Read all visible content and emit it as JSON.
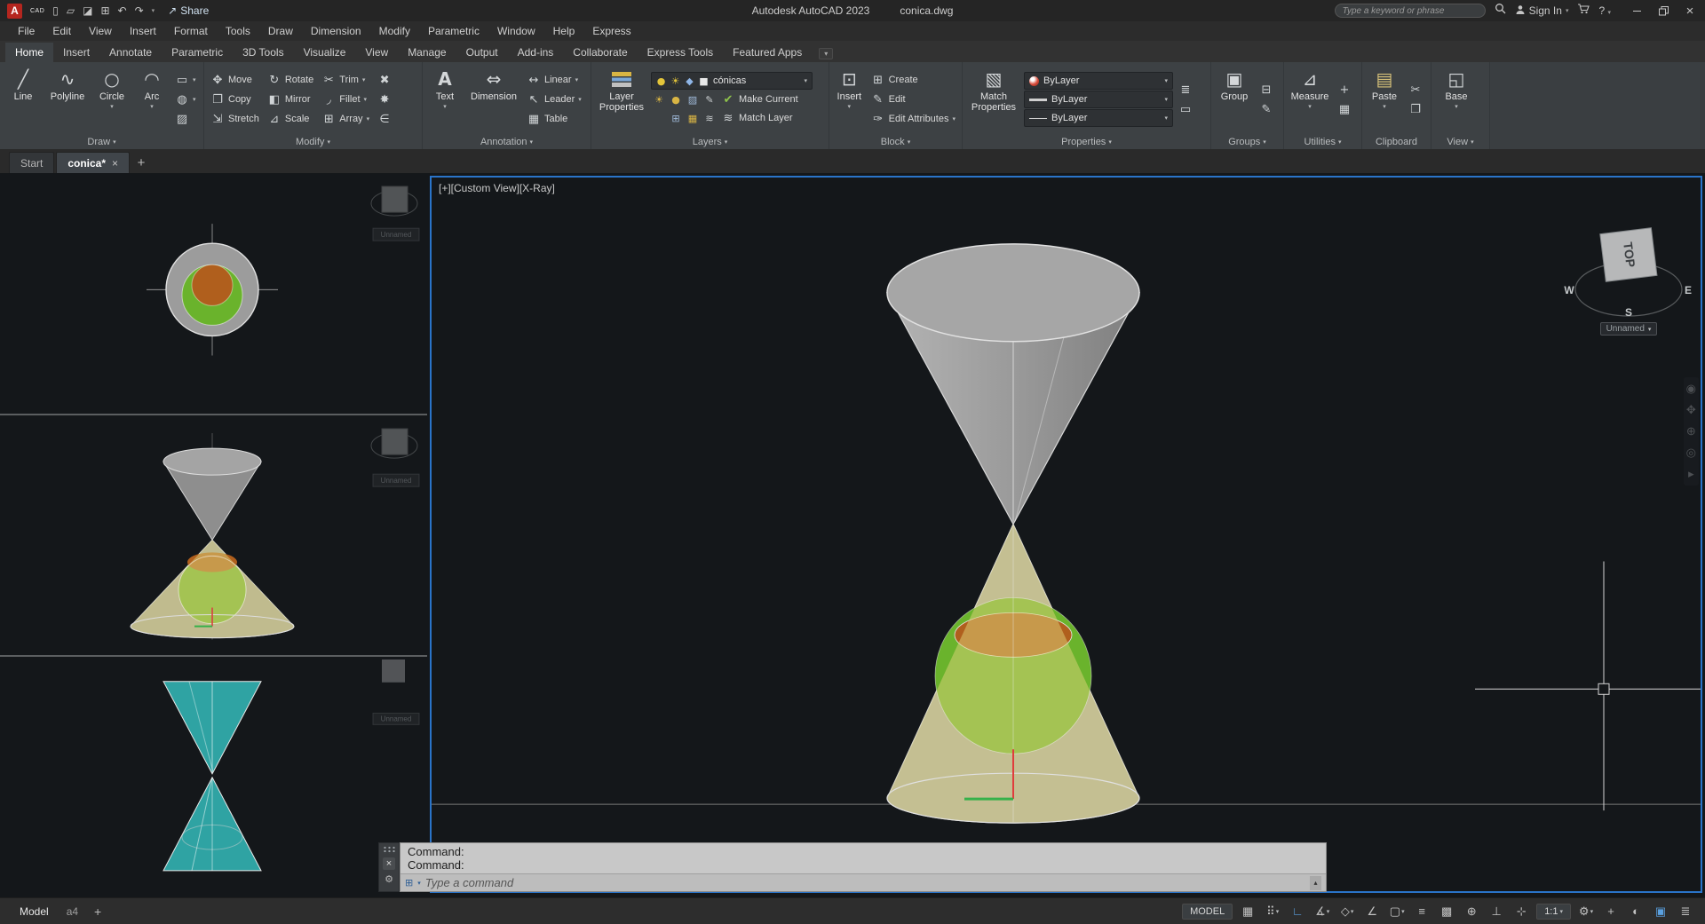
{
  "titlebar": {
    "logo": "A",
    "logo_sub": "CAD",
    "share": "Share",
    "app_title": "Autodesk AutoCAD 2023",
    "doc_title": "conica.dwg",
    "search_placeholder": "Type a keyword or phrase",
    "sign_in": "Sign In",
    "help": "?",
    "close": "×"
  },
  "menubar": [
    "File",
    "Edit",
    "View",
    "Insert",
    "Format",
    "Tools",
    "Draw",
    "Dimension",
    "Modify",
    "Parametric",
    "Window",
    "Help",
    "Express"
  ],
  "ribbon_tabs": [
    "Home",
    "Insert",
    "Annotate",
    "Parametric",
    "3D Tools",
    "Visualize",
    "View",
    "Manage",
    "Output",
    "Add-ins",
    "Collaborate",
    "Express Tools",
    "Featured Apps"
  ],
  "panels": {
    "draw": {
      "label": "Draw",
      "line": "Line",
      "polyline": "Polyline",
      "circle": "Circle",
      "arc": "Arc"
    },
    "modify": {
      "label": "Modify",
      "move": "Move",
      "copy": "Copy",
      "stretch": "Stretch",
      "rotate": "Rotate",
      "mirror": "Mirror",
      "scale": "Scale",
      "trim": "Trim",
      "fillet": "Fillet",
      "array": "Array"
    },
    "annotation": {
      "label": "Annotation",
      "text": "Text",
      "dimension": "Dimension",
      "linear": "Linear",
      "leader": "Leader",
      "table": "Table"
    },
    "layers": {
      "label": "Layers",
      "layer_properties": "Layer Properties",
      "current_layer": "cónicas",
      "make_current": "Make Current",
      "match_layer": "Match Layer"
    },
    "block": {
      "label": "Block",
      "insert": "Insert",
      "create": "Create",
      "edit": "Edit",
      "edit_attributes": "Edit Attributes"
    },
    "properties": {
      "label": "Properties",
      "match_properties": "Match Properties",
      "color": "ByLayer",
      "lineweight": "ByLayer",
      "linetype": "ByLayer"
    },
    "groups": {
      "label": "Groups",
      "group": "Group"
    },
    "utilities": {
      "label": "Utilities",
      "measure": "Measure"
    },
    "clipboard": {
      "label": "Clipboard",
      "paste": "Paste"
    },
    "view": {
      "label": "View",
      "base": "Base"
    }
  },
  "file_tabs": {
    "start": "Start",
    "active": "conica*",
    "close": "×",
    "add": "+"
  },
  "canvas": {
    "viewport_label": "[+][Custom View][X-Ray]",
    "viewcube": {
      "face": "TOP",
      "west": "W",
      "south": "S",
      "east": "E",
      "named_view": "Unnamed"
    }
  },
  "command": {
    "line1": "Command:",
    "line2": "Command:",
    "placeholder": "Type a command",
    "close": "×"
  },
  "statusbar": {
    "model_tab": "Model",
    "layout_tab": "a4",
    "add_layout": "+",
    "model_toggle": "MODEL",
    "annotation_scale": "1:1"
  },
  "status_icons": [
    {
      "glyph": "▦",
      "name": "grid"
    },
    {
      "glyph": "⠿",
      "name": "snap"
    },
    {
      "glyph": "∟",
      "name": "ortho"
    },
    {
      "glyph": "∡",
      "name": "polar-tracking"
    },
    {
      "glyph": "◇",
      "name": "isodraft"
    },
    {
      "glyph": "∠",
      "name": "object-snap-tracking"
    },
    {
      "glyph": "▢",
      "name": "object-snap"
    },
    {
      "glyph": "≡",
      "name": "lineweight"
    },
    {
      "glyph": "▩",
      "name": "transparency"
    },
    {
      "glyph": "⊕",
      "name": "selection-cycling"
    },
    {
      "glyph": "⊥",
      "name": "dynamic-ucs"
    },
    {
      "glyph": "⊹",
      "name": "dynamic-input"
    }
  ],
  "status_icons_right": [
    {
      "glyph": "⚙",
      "name": "workspace-switching"
    },
    {
      "glyph": "+",
      "name": "annotation-monitor"
    },
    {
      "glyph": "◐",
      "name": "isolate-objects"
    },
    {
      "glyph": "▣",
      "name": "graphics-performance"
    },
    {
      "glyph": "≣",
      "name": "customization"
    }
  ],
  "icons": {
    "caret": "▾",
    "new": "▯",
    "open": "▱",
    "save": "◪",
    "plot": "⊞",
    "undo": "↶",
    "redo": "↷",
    "share": "↗",
    "line": "╱",
    "polyline": "∿",
    "circle": "○",
    "arc": "◠",
    "rectangle": "▭",
    "ellipse": "◍",
    "hatch": "▨",
    "move": "✥",
    "copy": "❐",
    "stretch": "⇲",
    "rotate": "↻",
    "mirror": "◧",
    "scale": "⊿",
    "trim": "✂",
    "fillet": "◞",
    "array": "⊞",
    "erase": "✖",
    "explode": "✸",
    "more": "∈",
    "text": "A",
    "dimension": "⇔",
    "linear": "↔",
    "leader": "↖",
    "table": "▦",
    "bulb": "●",
    "sun": "☀",
    "lock": "◆",
    "swatch": "■",
    "make_current": "✔",
    "match_layer": "≋",
    "insert": "⊡",
    "create": "⊞",
    "edit": "✎",
    "edit_attributes": "✑",
    "match_properties": "▧",
    "group": "▣",
    "ungroup": "⊟",
    "list": "≣",
    "measure": "⊿",
    "id_point": "+",
    "calculator": "▦",
    "paste": "▤",
    "cut": "✂",
    "base": "◱",
    "cmd_input": "⊞",
    "scroll_up": "▴",
    "wrench": "⚙",
    "nav": [
      "◉",
      "✥",
      "⊕",
      "◎",
      "▸"
    ]
  },
  "colors": {
    "viewport_border": "#2a74c9",
    "sphere_green": "#6ab32c",
    "cone_orange": "#b05f1d",
    "teal_cone": "#2fa3a3",
    "status_active": "#5aa0e0"
  }
}
